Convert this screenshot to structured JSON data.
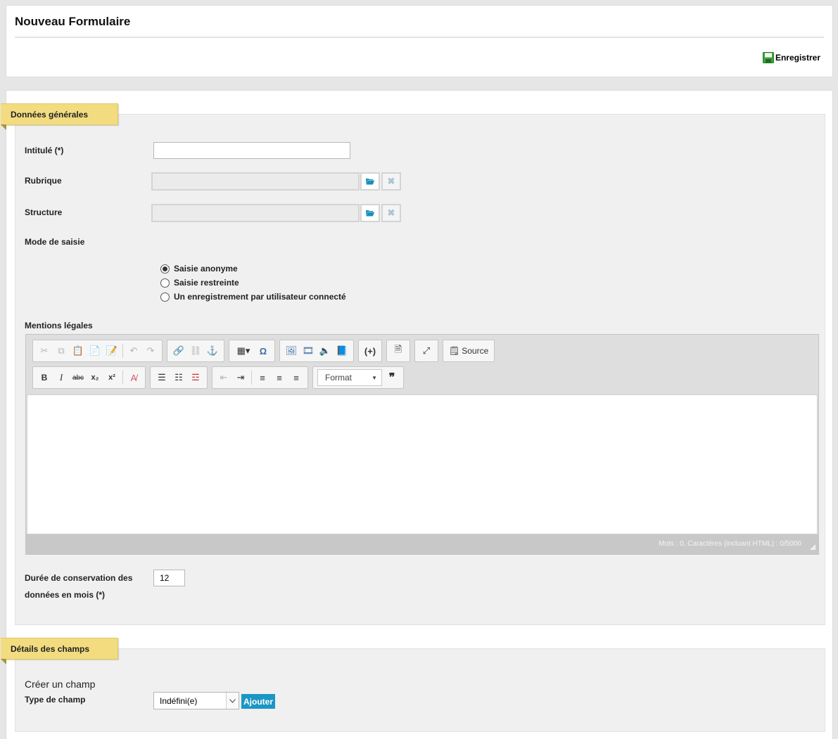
{
  "header": {
    "title": "Nouveau Formulaire",
    "save_label": "Enregistrer"
  },
  "general": {
    "tab_label": "Données générales",
    "title_label": "Intitulé (*)",
    "title_value": "",
    "rubrique_label": "Rubrique",
    "structure_label": "Structure",
    "mode_label": "Mode de saisie",
    "modes": [
      {
        "label": "Saisie anonyme",
        "checked": true
      },
      {
        "label": "Saisie restreinte",
        "checked": false
      },
      {
        "label": "Un enregistrement par utilisateur connecté",
        "checked": false
      }
    ],
    "legal_label": "Mentions légales",
    "retention_label_1": "Durée de conservation des",
    "retention_label_2": "données en mois (*)",
    "retention_value": "12"
  },
  "editor": {
    "source_label": "Source",
    "format_label": "Format",
    "counter": "Mots : 0, Caractères (incluant HTML) : 0/5000"
  },
  "fields": {
    "tab_label": "Détails des champs",
    "create_label": "Créer un champ",
    "type_label": "Type de champ",
    "type_value": "Indéfini(e)",
    "add_label": "Ajouter"
  },
  "colors": {
    "tab_bg": "#f2dc7f",
    "add_button": "#1b97c4",
    "save_icon": "#3aa53a",
    "folder_icon": "#1a8fbd"
  }
}
